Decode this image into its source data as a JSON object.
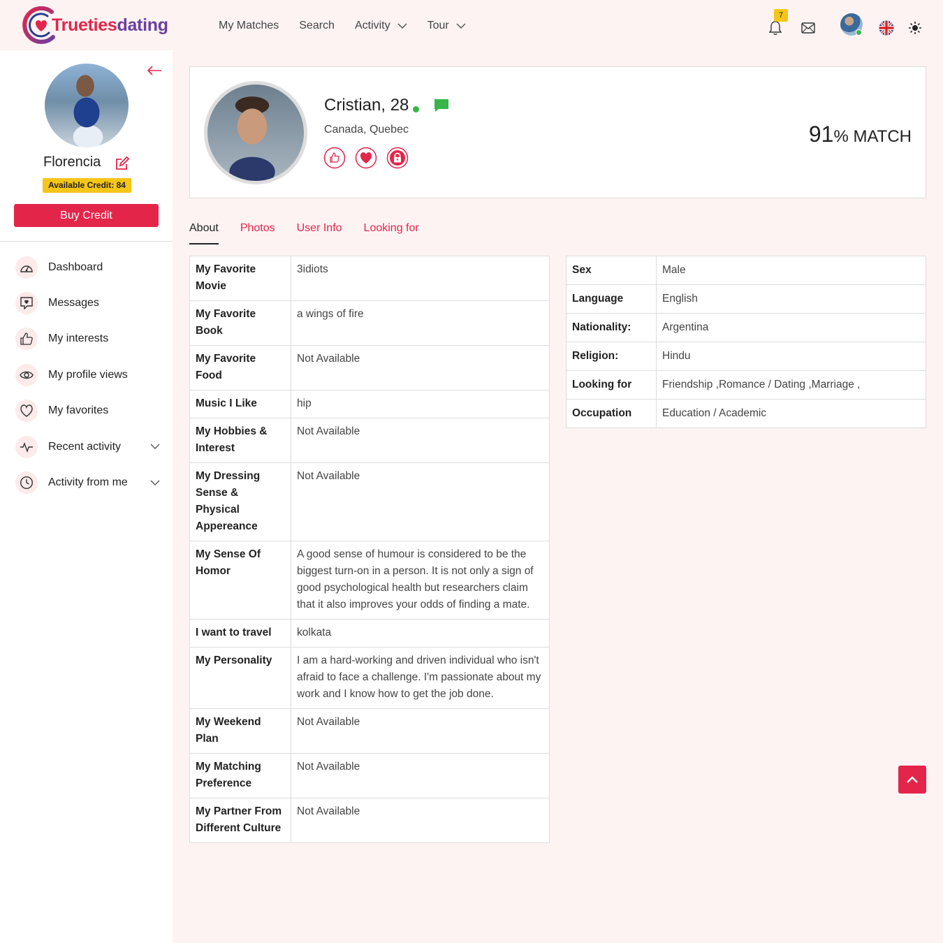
{
  "brand": {
    "name_part1": "Trueties",
    "name_part2": "dating"
  },
  "nav": {
    "items": [
      {
        "label": "My Matches",
        "dropdown": false
      },
      {
        "label": "Search",
        "dropdown": false
      },
      {
        "label": "Activity",
        "dropdown": true
      },
      {
        "label": "Tour",
        "dropdown": true
      }
    ],
    "notification_count": "7",
    "icons": [
      "bell-icon",
      "mail-icon",
      "user-avatar",
      "uk-flag-icon",
      "sun-icon"
    ]
  },
  "sidebar": {
    "user_name": "Florencia",
    "credit_label": "Available Credit: 84",
    "buy_button": "Buy Credit",
    "menu": [
      {
        "label": "Dashboard",
        "icon": "dashboard-icon"
      },
      {
        "label": "Messages",
        "icon": "message-heart-icon"
      },
      {
        "label": "My interests",
        "icon": "thumbs-up-icon"
      },
      {
        "label": "My profile views",
        "icon": "eye-icon"
      },
      {
        "label": "My favorites",
        "icon": "heart-icon"
      },
      {
        "label": "Recent activity",
        "icon": "pulse-icon",
        "expandable": true
      },
      {
        "label": "Activity from me",
        "icon": "clock-icon",
        "expandable": true
      }
    ]
  },
  "profile": {
    "name_age": "Cristian, 28",
    "location": "Canada, Quebec",
    "match_percent": "91",
    "match_suffix": "% MATCH",
    "online": true
  },
  "tabs": [
    {
      "label": "About",
      "active": true
    },
    {
      "label": "Photos",
      "active": false
    },
    {
      "label": "User Info",
      "active": false
    },
    {
      "label": "Looking for",
      "active": false
    }
  ],
  "about_rows": [
    {
      "key": "My Favorite Movie",
      "value": "3idiots"
    },
    {
      "key": "My Favorite Book",
      "value": "a wings of fire"
    },
    {
      "key": "My Favorite Food",
      "value": "Not Available"
    },
    {
      "key": "Music I Like",
      "value": "hip"
    },
    {
      "key": "My Hobbies & Interest",
      "value": "Not Available"
    },
    {
      "key": "My Dressing Sense & Physical Appereance",
      "value": "Not Available"
    },
    {
      "key": "My Sense Of Homor",
      "value": "A good sense of humour is considered to be the biggest turn-on in a person. It is not only a sign of good psychological health but researchers claim that it also improves your odds of finding a mate."
    },
    {
      "key": "I want to travel",
      "value": "kolkata"
    },
    {
      "key": "My Personality",
      "value": "I am a hard-working and driven individual who isn't afraid to face a challenge. I'm passionate about my work and I know how to get the job done."
    },
    {
      "key": "My Weekend Plan",
      "value": "Not Available"
    },
    {
      "key": "My Matching Preference",
      "value": "Not Available"
    },
    {
      "key": "My Partner From Different Culture",
      "value": "Not Available"
    }
  ],
  "info_rows": [
    {
      "key": "Sex",
      "value": "Male"
    },
    {
      "key": "Language",
      "value": "English"
    },
    {
      "key": "Nationality:",
      "value": "Argentina"
    },
    {
      "key": "Religion:",
      "value": "Hindu"
    },
    {
      "key": "Looking for",
      "value": "Friendship ,Romance / Dating ,Marriage ,"
    },
    {
      "key": "Occupation",
      "value": "Education / Academic"
    }
  ],
  "colors": {
    "accent": "#e4254a",
    "brand_purple": "#6b3fa0",
    "badge": "#f5c518",
    "online": "#39b54a",
    "bg": "#fdf3f3"
  }
}
